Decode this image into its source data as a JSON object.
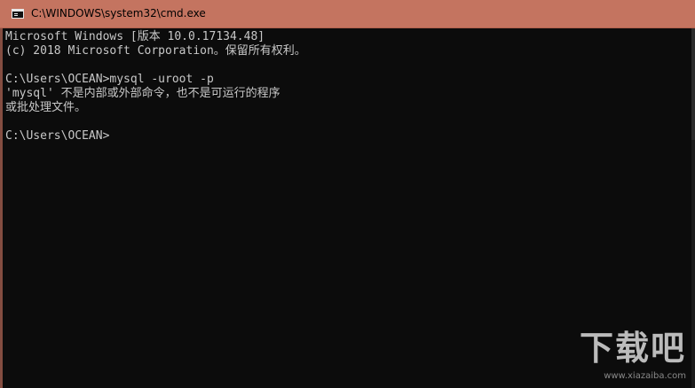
{
  "window": {
    "title": "C:\\WINDOWS\\system32\\cmd.exe",
    "titlebar_color": "#c47460",
    "background_color": "#0c0c0c",
    "text_color": "#c8c8c8"
  },
  "console": {
    "lines": [
      "Microsoft Windows [版本 10.0.17134.48]",
      "(c) 2018 Microsoft Corporation。保留所有权利。",
      "",
      "C:\\Users\\OCEAN>mysql -uroot -p",
      "'mysql' 不是内部或外部命令，也不是可运行的程序",
      "或批处理文件。",
      "",
      "C:\\Users\\OCEAN>"
    ]
  },
  "watermark": {
    "logo_text": "下载吧",
    "url_text": "www.xiazaiba.com"
  }
}
